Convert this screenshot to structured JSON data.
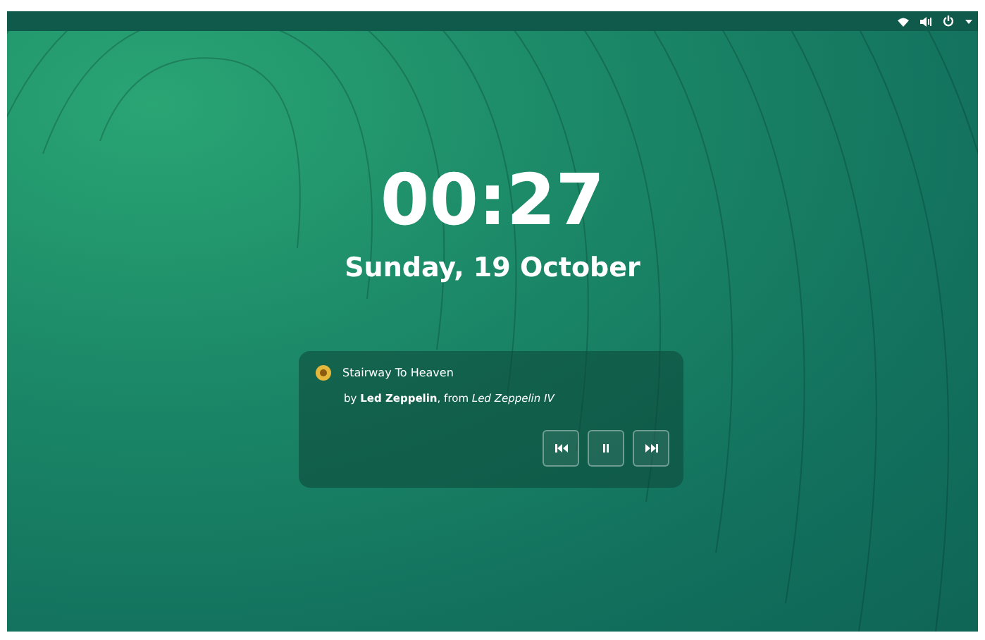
{
  "lock_screen": {
    "clock": "00:27",
    "date": "Sunday, 19 October"
  },
  "media_notification": {
    "title": "Stairway To Heaven",
    "subtitle": "by **Led Zeppelin**, from *Led Zeppelin IV*",
    "controls": [
      {
        "kind": "previous"
      },
      {
        "kind": "pause"
      },
      {
        "kind": "next"
      }
    ]
  }
}
